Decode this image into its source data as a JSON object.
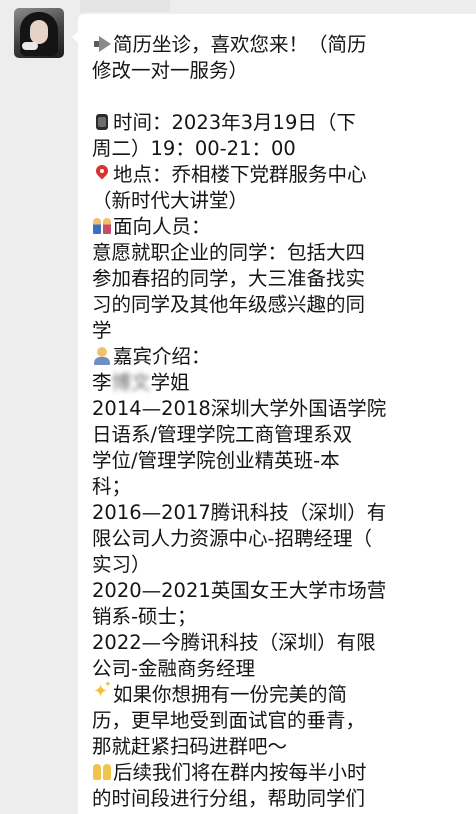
{
  "message": {
    "lines": [
      "简历坐诊，喜欢您来！（简历",
      "修改一对一服务）",
      "",
      "时间：2023年3月19日（下",
      "周二）19：00-21：00",
      "地点：乔相楼下党群服务中心",
      "（新时代大讲堂）",
      "面向人员：",
      "意愿就职企业的同学：包括大四",
      "参加春招的同学，大三准备找实",
      "习的同学及其他年级感兴趣的同",
      "学",
      "嘉宾介绍：",
      "李",
      "学姐",
      "2014—2018深圳大学外国语学院",
      "日语系/管理学院工商管理系双",
      "学位/管理学院创业精英班-本",
      "科；",
      "2016—2017腾讯科技（深圳）有",
      "限公司人力资源中心-招聘经理（",
      "实习）",
      "2020—2021英国女王大学市场营",
      "销系-硕士；",
      "2022—今腾讯科技（深圳）有限",
      "公司-金融商务经理",
      "如果你想拥有一份完美的简",
      "历，更早地受到面试官的垂青，",
      "那就赶紧扫码进群吧～",
      "后续我们将在群内按每半小时",
      "的时间段进行分组，帮助同学们"
    ],
    "redacted_text": "博文"
  },
  "icons": [
    "megaphone-icon",
    "watch-icon",
    "pin-icon",
    "people-icon",
    "person-icon",
    "sparkles-icon",
    "raised-hands-icon"
  ],
  "colors": {
    "background": "#ededed",
    "bubble": "#ffffff",
    "text": "#151515"
  }
}
